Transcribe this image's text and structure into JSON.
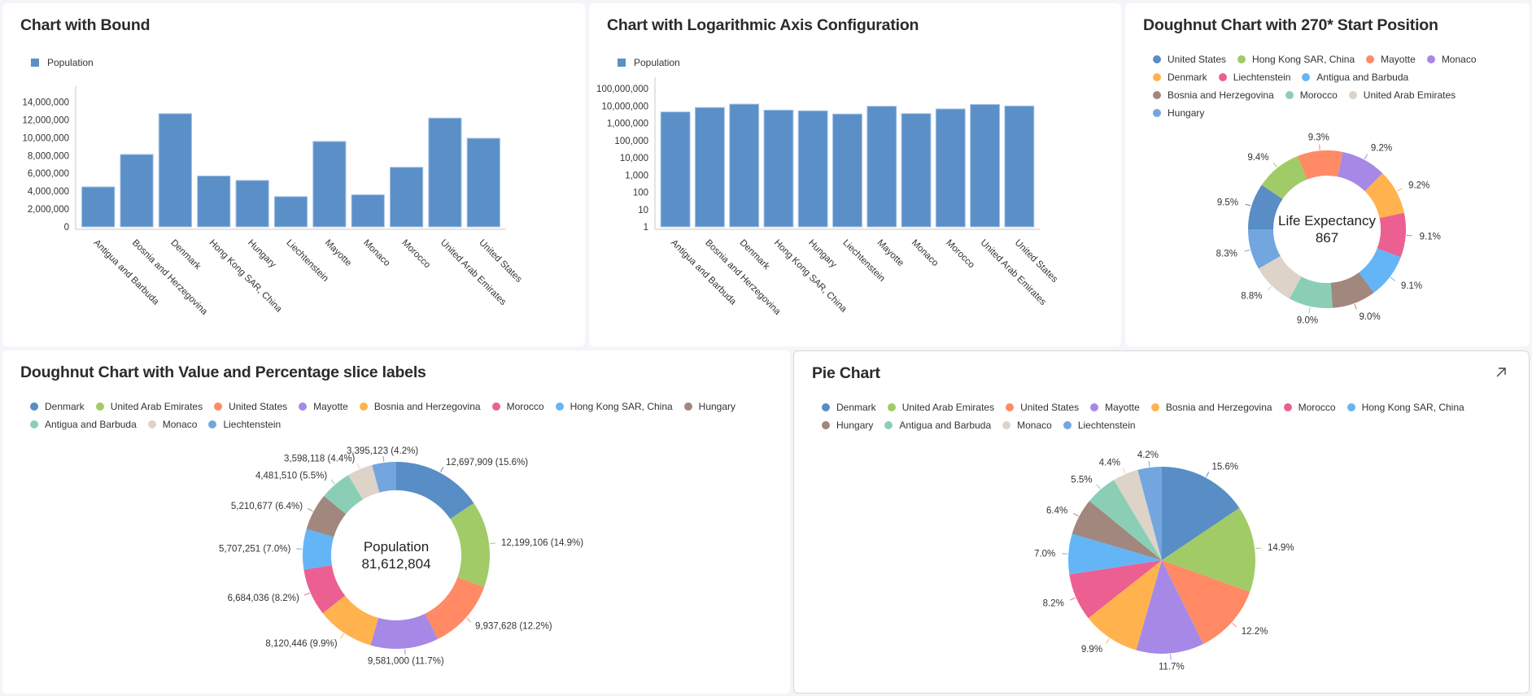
{
  "colors": {
    "bar": "#5b8fc8",
    "axis": "#c8c8c8",
    "palette": {
      "United States": "#ff8a65",
      "Hong Kong SAR, China": "#64b5f6",
      "Mayotte": "#a688e6",
      "Monaco": "#ddd3c9",
      "Denmark": "#588dc6",
      "Liechtenstein": "#73a6df",
      "Antigua and Barbuda": "#8acfb5",
      "Bosnia and Herzegovina": "#ffb24d",
      "Morocco": "#ec5f91",
      "United Arab Emirates": "#a1cb67",
      "Hungary": "#a1877d"
    },
    "palette_270": {
      "United States": "#588dc6",
      "Hong Kong SAR, China": "#a1cb67",
      "Mayotte": "#ff8a65",
      "Monaco": "#a688e6",
      "Denmark": "#ffb24d",
      "Liechtenstein": "#ec5f91",
      "Antigua and Barbuda": "#64b5f6",
      "Bosnia and Herzegovina": "#a1877d",
      "Morocco": "#8acfb5",
      "United Arab Emirates": "#ddd3c9",
      "Hungary": "#73a6df"
    }
  },
  "panels": {
    "bound": {
      "title": "Chart with Bound"
    },
    "log": {
      "title": "Chart with Logarithmic Axis Configuration"
    },
    "donut270": {
      "title": "Doughnut Chart with 270* Start Position"
    },
    "donutValue": {
      "title": "Doughnut Chart with Value and Percentage slice labels"
    },
    "pie": {
      "title": "Pie Chart",
      "expand_icon": "expand-arrow-icon"
    }
  },
  "chart_data": [
    {
      "id": "bound",
      "type": "bar",
      "title": "Chart with Bound",
      "legend": [
        "Population"
      ],
      "legend_position": "top-left",
      "categories": [
        "Antigua and Barbuda",
        "Bosnia and Herzegovina",
        "Denmark",
        "Hong Kong SAR, China",
        "Hungary",
        "Liechtenstein",
        "Mayotte",
        "Monaco",
        "Morocco",
        "United Arab Emirates",
        "United States"
      ],
      "series": [
        {
          "name": "Population",
          "values": [
            4481510,
            8120446,
            12697909,
            5707251,
            5210677,
            3395123,
            9581000,
            3598118,
            6684036,
            12199106,
            9937628
          ]
        }
      ],
      "yticks": [
        "0",
        "2,000,000",
        "4,000,000",
        "6,000,000",
        "8,000,000",
        "10,000,000",
        "12,000,000",
        "14,000,000"
      ],
      "ylim": [
        0,
        14500000
      ],
      "xlabel": "",
      "ylabel": "",
      "grid": false
    },
    {
      "id": "log",
      "type": "bar",
      "title": "Chart with Logarithmic Axis Configuration",
      "legend": [
        "Population"
      ],
      "legend_position": "top-left",
      "yscale": "log",
      "categories": [
        "Antigua and Barbuda",
        "Bosnia and Herzegovina",
        "Denmark",
        "Hong Kong SAR, China",
        "Hungary",
        "Liechtenstein",
        "Mayotte",
        "Monaco",
        "Morocco",
        "United Arab Emirates",
        "United States"
      ],
      "series": [
        {
          "name": "Population",
          "values": [
            4481510,
            8120446,
            12697909,
            5707251,
            5210677,
            3395123,
            9581000,
            3598118,
            6684036,
            12199106,
            9937628
          ]
        }
      ],
      "yticks": [
        "1",
        "10",
        "100",
        "1,000",
        "10,000",
        "100,000",
        "1,000,000",
        "10,000,000",
        "100,000,000"
      ],
      "ylim": [
        1,
        100000000
      ],
      "xlabel": "",
      "ylabel": "",
      "grid": false
    },
    {
      "id": "donut270",
      "type": "pie",
      "variant": "doughnut",
      "title": "Doughnut Chart with 270* Start Position",
      "start_angle_deg": 270,
      "center_label": "Life Expectancy",
      "center_value": "867",
      "legend_position": "top",
      "categories": [
        "United States",
        "Hong Kong SAR, China",
        "Mayotte",
        "Monaco",
        "Denmark",
        "Liechtenstein",
        "Antigua and Barbuda",
        "Bosnia and Herzegovina",
        "Morocco",
        "United Arab Emirates",
        "Hungary"
      ],
      "percent_labels": [
        "9.5%",
        "9.4%",
        "9.3%",
        "9.2%",
        "9.2%",
        "9.1%",
        "9.1%",
        "9.0%",
        "9.0%",
        "8.8%",
        "8.3%"
      ],
      "values": [
        82.4,
        81.5,
        80.6,
        79.8,
        79.8,
        78.9,
        78.9,
        78.0,
        78.0,
        76.3,
        72.0
      ]
    },
    {
      "id": "donutValue",
      "type": "pie",
      "variant": "doughnut",
      "title": "Doughnut Chart with Value and Percentage slice labels",
      "center_label": "Population",
      "center_value": "81,612,804",
      "legend_position": "top",
      "categories": [
        "Denmark",
        "United Arab Emirates",
        "United States",
        "Mayotte",
        "Bosnia and Herzegovina",
        "Morocco",
        "Hong Kong SAR, China",
        "Hungary",
        "Antigua and Barbuda",
        "Monaco",
        "Liechtenstein"
      ],
      "values": [
        12697909,
        12199106,
        9937628,
        9581000,
        8120446,
        6684036,
        5707251,
        5210677,
        4481510,
        3598118,
        3395123
      ],
      "slice_labels": [
        "12,697,909 (15.6%)",
        "12,199,106 (14.9%)",
        "9,937,628 (12.2%)",
        "9,581,000 (11.7%)",
        "8,120,446 (9.9%)",
        "6,684,036 (8.2%)",
        "5,707,251 (7.0%)",
        "5,210,677 (6.4%)",
        "4,481,510 (5.5%)",
        "3,598,118 (4.4%)",
        "3,395,123 (4.2%)"
      ]
    },
    {
      "id": "pie",
      "type": "pie",
      "title": "Pie Chart",
      "legend_position": "top",
      "categories": [
        "Denmark",
        "United Arab Emirates",
        "United States",
        "Mayotte",
        "Bosnia and Herzegovina",
        "Morocco",
        "Hong Kong SAR, China",
        "Hungary",
        "Antigua and Barbuda",
        "Monaco",
        "Liechtenstein"
      ],
      "values": [
        12697909,
        12199106,
        9937628,
        9581000,
        8120446,
        6684036,
        5707251,
        5210677,
        4481510,
        3598118,
        3395123
      ],
      "slice_labels": [
        "15.6%",
        "14.9%",
        "12.2%",
        "11.7%",
        "9.9%",
        "8.2%",
        "7.0%",
        "6.4%",
        "5.5%",
        "4.4%",
        "4.2%"
      ]
    }
  ]
}
